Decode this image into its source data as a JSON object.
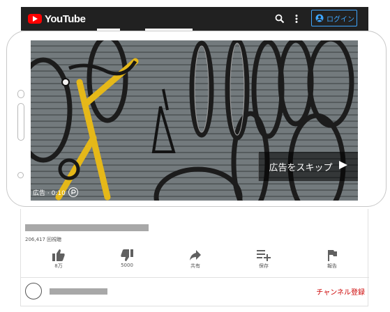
{
  "header": {
    "logo_text": "YouTube",
    "login_label": "ログイン",
    "colors": {
      "bar": "#212121",
      "brand_red": "#ff0000",
      "login_blue": "#3ea6ff"
    }
  },
  "video": {
    "skip_label": "広告をスキップ",
    "ad_label": "広告 · 0:10"
  },
  "info": {
    "views": "206,417 回視聴"
  },
  "actions": [
    {
      "icon": "thumbs-up-icon",
      "label": "8万"
    },
    {
      "icon": "thumbs-down-icon",
      "label": "5000"
    },
    {
      "icon": "share-icon",
      "label": "共有"
    },
    {
      "icon": "playlist-add-icon",
      "label": "保存"
    },
    {
      "icon": "flag-icon",
      "label": "報告"
    }
  ],
  "channel": {
    "subscribe_label": "チャンネル登録",
    "subscribe_color": "#cc0000"
  }
}
